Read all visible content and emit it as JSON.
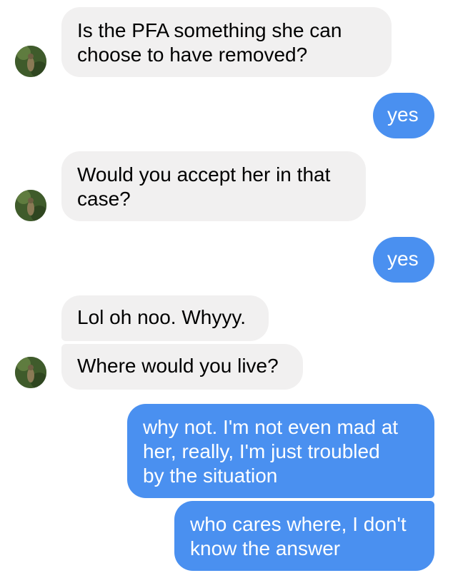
{
  "conversation": {
    "messages": [
      {
        "sender": "contact",
        "text": "Is the PFA something she can\nchoose to have removed?"
      },
      {
        "sender": "me",
        "text": "yes"
      },
      {
        "sender": "contact",
        "text": "Would you accept her in that\ncase?"
      },
      {
        "sender": "me",
        "text": "yes"
      },
      {
        "sender": "contact",
        "text": "Lol oh noo. Whyyy."
      },
      {
        "sender": "contact",
        "text": "Where would you live?"
      },
      {
        "sender": "me",
        "text": "why not. I'm not even mad at\nher, really, I'm just troubled\nby the situation"
      },
      {
        "sender": "me",
        "text": "who cares where, I don't\nknow the answer"
      }
    ]
  },
  "colors": {
    "incoming_bubble": "#f1f0f0",
    "outgoing_bubble": "#4a90f0",
    "incoming_text": "#000000",
    "outgoing_text": "#ffffff"
  },
  "icons": {
    "contact_avatar": "profile-photo-icon"
  }
}
